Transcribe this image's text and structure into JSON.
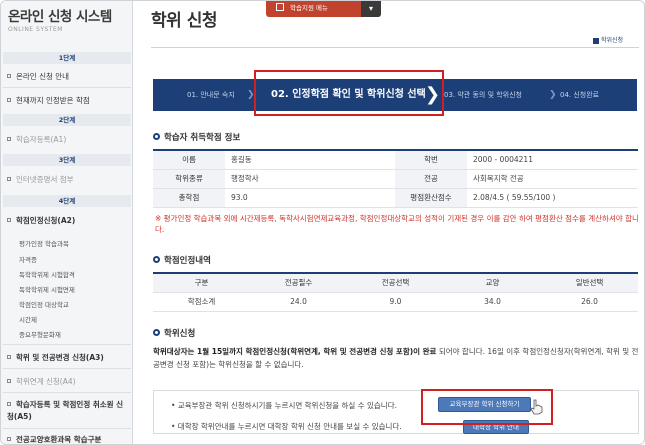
{
  "sidebar": {
    "title": "온라인 신청 시스템",
    "subtitle": "ONLINE SYSTEM",
    "step1": "1단계",
    "item_online_guide": "온라인 신청 안내",
    "item_recognized": "현재까지 인정받은 학점",
    "step2": "2단계",
    "item_learner_reg": "학습자등록(A1)",
    "step3": "3단계",
    "item_internet_cert": "인터넷증명서 첨부",
    "step4": "4단계",
    "item_credit_app": "학점인정신청(A2)",
    "sub_items": [
      "평가인정 학습과목",
      "자격증",
      "독학학위제 시험합격",
      "독학학위제 시험면제",
      "학점인정 대상학교",
      "시간제",
      "중요무형문화재"
    ],
    "item_degree_major": "학위 및 전공변경 신청(A3)",
    "item_degree_link": "학위연계 신청(A4)",
    "item_cancel": "학습자등록 및 학점인정 취소원 신청(A5)",
    "item_liberal": "전공교양호환과목 학습구분"
  },
  "header": {
    "page_title": "학위 신청",
    "top_menu_label": "학습지원 메뉴",
    "top_menu_arrow": "▾",
    "breadcrumb": "학위신청"
  },
  "steps": {
    "s1": "01. 안내문 숙지",
    "s2": "02. 인정학점 확인 및 학위신청 선택",
    "s3": "03. 약관 동의 및 학위신청",
    "s4": "04. 신청완료",
    "chev": "❯",
    "sep": "❯"
  },
  "learner": {
    "section_title": "학습자 취득학점 정보",
    "labels": {
      "name": "이름",
      "id": "학번",
      "degree_type": "학위종류",
      "major": "전공",
      "total": "총학점",
      "gpa": "평점환산점수"
    },
    "values": {
      "name": "홍길동",
      "id": "2000 - 0004211",
      "degree_type": "행정학사",
      "major": "사회복지학 전공",
      "total": "93.0",
      "gpa": "2.08/4.5 ( 59.55/100 )"
    }
  },
  "note": "※ 평가인정 학습과목 외에 시간제등록, 독학사시험면제교육과정, 학점인정대상학교의 성적이 기재된 경우 이를 감안 하여 평점환산 점수를 계산하셔야 합니다.",
  "recognition": {
    "section_title": "학점인정내역",
    "headers": [
      "구분",
      "전공필수",
      "전공선택",
      "교양",
      "일반선택"
    ],
    "row": [
      "학점소계",
      "24.0",
      "9.0",
      "34.0",
      "26.0"
    ]
  },
  "degree_app": {
    "section_title": "학위신청",
    "para_bold": "학위대상자는 1월 15일까지 학점인정신청(학위연계, 학위 및 전공변경 신청 포함)이 완료",
    "para_rest": " 되어야 합니다. 16일 이후 학점인정신청자(학위연계, 학위 및 전공변경 신청 포함)는 학위신청을 할 수 없습니다.",
    "bullet1": "• 교육부장관 학위 신청하시기를 누르시면 학위신청을 하실 수 있습니다.",
    "bullet2": "• 대학장 학위안내를 누르시면 대학장 학위 신청 안내를 보실 수 있습니다.",
    "btn_apply": "교육부장관 학위 신청하기",
    "btn_info": "대학장 학위 안내"
  }
}
